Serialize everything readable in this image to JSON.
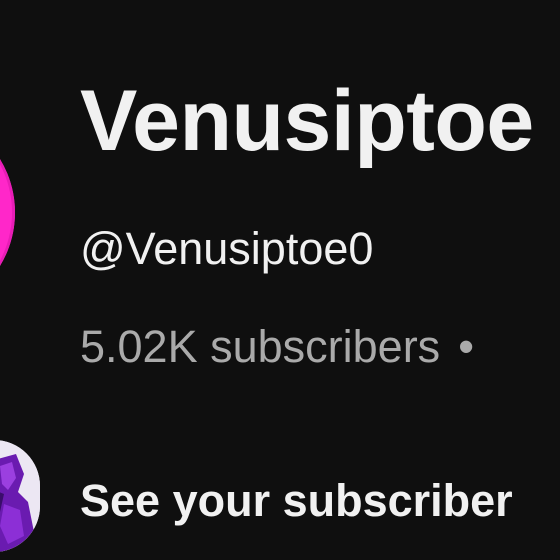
{
  "channel": {
    "name": "Venusiptoe",
    "handle": "@Venusiptoe0",
    "subscribers": "5.02K subscribers",
    "separator": "•",
    "avatar_color": "#ff27c9"
  },
  "cta": {
    "label": "See your subscriber"
  },
  "user": {
    "avatar_accent": "#7a1fc2"
  },
  "colors": {
    "background": "#0f0f0f",
    "primary_text": "#f1f1f1",
    "secondary_text": "#aaaaaa"
  }
}
